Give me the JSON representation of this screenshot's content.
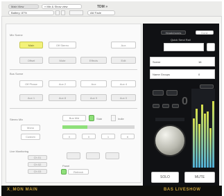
{
  "topbar": {
    "main_view": "Main View",
    "view_select": "« Mix & Show view",
    "title": "TDM »",
    "battery": "Battery: 87%",
    "gear": "⚙",
    "alt_view": "Alt/ Fade"
  },
  "left": {
    "section1_title": "Mix Scene",
    "row1": [
      "Main",
      "Off Stereo",
      "Aux"
    ],
    "row2": [
      "Offset",
      "Mute",
      "Effects",
      "Edit"
    ],
    "section2_title": "Bus Scene",
    "row3": [
      "Off Phase",
      "Aux 2",
      "Aux",
      "Aux 4"
    ],
    "row4": [
      "Aux 1",
      "Aux 8",
      "Aux 9",
      "Aux 0"
    ],
    "stereo_label": "Stereo Mix",
    "stereo_btns": [
      "Bus Mid",
      "Stab",
      "Indie"
    ],
    "side_btns": [
      "Mono",
      "Custom"
    ],
    "small_vals": [
      "0",
      "0",
      "1",
      "6"
    ],
    "monitor_label": "Live Monitoring",
    "monitor_items": [
      "Ch 01",
      "Ch 02",
      "Ch 03"
    ],
    "panel_label": "Panel",
    "reset_label": "Refresh"
  },
  "right": {
    "top_btns": [
      "Headphones",
      "Done"
    ],
    "header": "Quick Send Rail",
    "field1_label": "Scene",
    "field1_value": "Preset",
    "field1_num": "16",
    "field2_label": "Name Groups",
    "field2_num": "0",
    "read_value": "0",
    "solo_label": "SOLO",
    "mute_label": "MUTE"
  },
  "meters": [
    0.62,
    0.75,
    0.55,
    0.8,
    0.68,
    0.71,
    0.5,
    0.84
  ],
  "bottom": {
    "left": "X_MON MAIN",
    "right": "BAS LIVESHOW"
  }
}
